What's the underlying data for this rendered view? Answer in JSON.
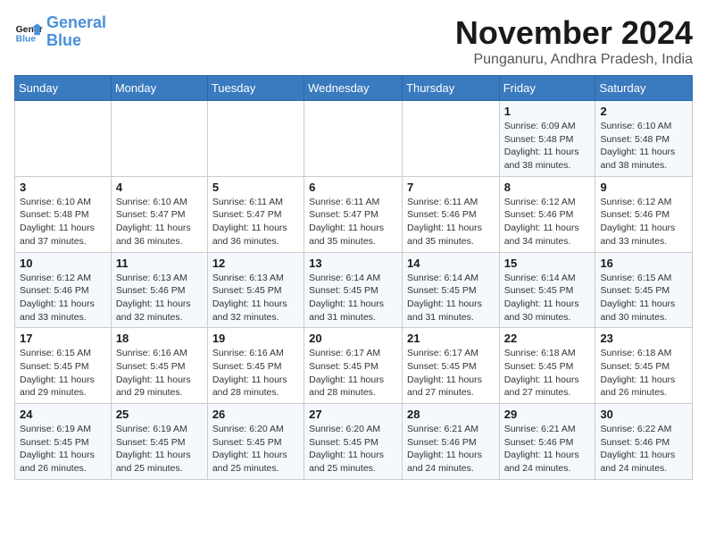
{
  "header": {
    "logo_text_general": "General",
    "logo_text_blue": "Blue",
    "month_title": "November 2024",
    "location": "Punganuru, Andhra Pradesh, India"
  },
  "days_of_week": [
    "Sunday",
    "Monday",
    "Tuesday",
    "Wednesday",
    "Thursday",
    "Friday",
    "Saturday"
  ],
  "weeks": [
    [
      {
        "day": "",
        "info": ""
      },
      {
        "day": "",
        "info": ""
      },
      {
        "day": "",
        "info": ""
      },
      {
        "day": "",
        "info": ""
      },
      {
        "day": "",
        "info": ""
      },
      {
        "day": "1",
        "info": "Sunrise: 6:09 AM\nSunset: 5:48 PM\nDaylight: 11 hours and 38 minutes."
      },
      {
        "day": "2",
        "info": "Sunrise: 6:10 AM\nSunset: 5:48 PM\nDaylight: 11 hours and 38 minutes."
      }
    ],
    [
      {
        "day": "3",
        "info": "Sunrise: 6:10 AM\nSunset: 5:48 PM\nDaylight: 11 hours and 37 minutes."
      },
      {
        "day": "4",
        "info": "Sunrise: 6:10 AM\nSunset: 5:47 PM\nDaylight: 11 hours and 36 minutes."
      },
      {
        "day": "5",
        "info": "Sunrise: 6:11 AM\nSunset: 5:47 PM\nDaylight: 11 hours and 36 minutes."
      },
      {
        "day": "6",
        "info": "Sunrise: 6:11 AM\nSunset: 5:47 PM\nDaylight: 11 hours and 35 minutes."
      },
      {
        "day": "7",
        "info": "Sunrise: 6:11 AM\nSunset: 5:46 PM\nDaylight: 11 hours and 35 minutes."
      },
      {
        "day": "8",
        "info": "Sunrise: 6:12 AM\nSunset: 5:46 PM\nDaylight: 11 hours and 34 minutes."
      },
      {
        "day": "9",
        "info": "Sunrise: 6:12 AM\nSunset: 5:46 PM\nDaylight: 11 hours and 33 minutes."
      }
    ],
    [
      {
        "day": "10",
        "info": "Sunrise: 6:12 AM\nSunset: 5:46 PM\nDaylight: 11 hours and 33 minutes."
      },
      {
        "day": "11",
        "info": "Sunrise: 6:13 AM\nSunset: 5:46 PM\nDaylight: 11 hours and 32 minutes."
      },
      {
        "day": "12",
        "info": "Sunrise: 6:13 AM\nSunset: 5:45 PM\nDaylight: 11 hours and 32 minutes."
      },
      {
        "day": "13",
        "info": "Sunrise: 6:14 AM\nSunset: 5:45 PM\nDaylight: 11 hours and 31 minutes."
      },
      {
        "day": "14",
        "info": "Sunrise: 6:14 AM\nSunset: 5:45 PM\nDaylight: 11 hours and 31 minutes."
      },
      {
        "day": "15",
        "info": "Sunrise: 6:14 AM\nSunset: 5:45 PM\nDaylight: 11 hours and 30 minutes."
      },
      {
        "day": "16",
        "info": "Sunrise: 6:15 AM\nSunset: 5:45 PM\nDaylight: 11 hours and 30 minutes."
      }
    ],
    [
      {
        "day": "17",
        "info": "Sunrise: 6:15 AM\nSunset: 5:45 PM\nDaylight: 11 hours and 29 minutes."
      },
      {
        "day": "18",
        "info": "Sunrise: 6:16 AM\nSunset: 5:45 PM\nDaylight: 11 hours and 29 minutes."
      },
      {
        "day": "19",
        "info": "Sunrise: 6:16 AM\nSunset: 5:45 PM\nDaylight: 11 hours and 28 minutes."
      },
      {
        "day": "20",
        "info": "Sunrise: 6:17 AM\nSunset: 5:45 PM\nDaylight: 11 hours and 28 minutes."
      },
      {
        "day": "21",
        "info": "Sunrise: 6:17 AM\nSunset: 5:45 PM\nDaylight: 11 hours and 27 minutes."
      },
      {
        "day": "22",
        "info": "Sunrise: 6:18 AM\nSunset: 5:45 PM\nDaylight: 11 hours and 27 minutes."
      },
      {
        "day": "23",
        "info": "Sunrise: 6:18 AM\nSunset: 5:45 PM\nDaylight: 11 hours and 26 minutes."
      }
    ],
    [
      {
        "day": "24",
        "info": "Sunrise: 6:19 AM\nSunset: 5:45 PM\nDaylight: 11 hours and 26 minutes."
      },
      {
        "day": "25",
        "info": "Sunrise: 6:19 AM\nSunset: 5:45 PM\nDaylight: 11 hours and 25 minutes."
      },
      {
        "day": "26",
        "info": "Sunrise: 6:20 AM\nSunset: 5:45 PM\nDaylight: 11 hours and 25 minutes."
      },
      {
        "day": "27",
        "info": "Sunrise: 6:20 AM\nSunset: 5:45 PM\nDaylight: 11 hours and 25 minutes."
      },
      {
        "day": "28",
        "info": "Sunrise: 6:21 AM\nSunset: 5:46 PM\nDaylight: 11 hours and 24 minutes."
      },
      {
        "day": "29",
        "info": "Sunrise: 6:21 AM\nSunset: 5:46 PM\nDaylight: 11 hours and 24 minutes."
      },
      {
        "day": "30",
        "info": "Sunrise: 6:22 AM\nSunset: 5:46 PM\nDaylight: 11 hours and 24 minutes."
      }
    ]
  ]
}
